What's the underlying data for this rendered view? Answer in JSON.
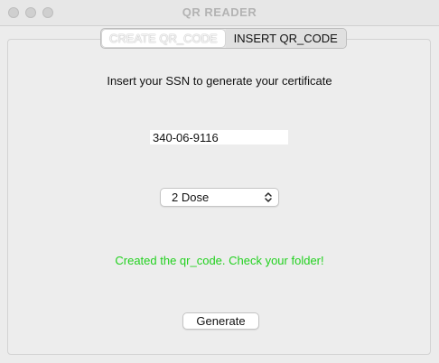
{
  "window": {
    "title": "QR READER"
  },
  "tabs": [
    {
      "label": "CREATE QR_CODE"
    },
    {
      "label": "INSERT QR_CODE"
    }
  ],
  "form": {
    "instruction": "Insert your SSN to generate your certificate",
    "ssn_value": "340-06-9116",
    "dose_select": {
      "selected": "2 Dose"
    },
    "status_message": "Created the qr_code. Check your folder!",
    "generate_label": "Generate"
  },
  "colors": {
    "status_text": "#22d11f",
    "window_bg": "#ececec",
    "title_text": "#b3b3b3"
  }
}
